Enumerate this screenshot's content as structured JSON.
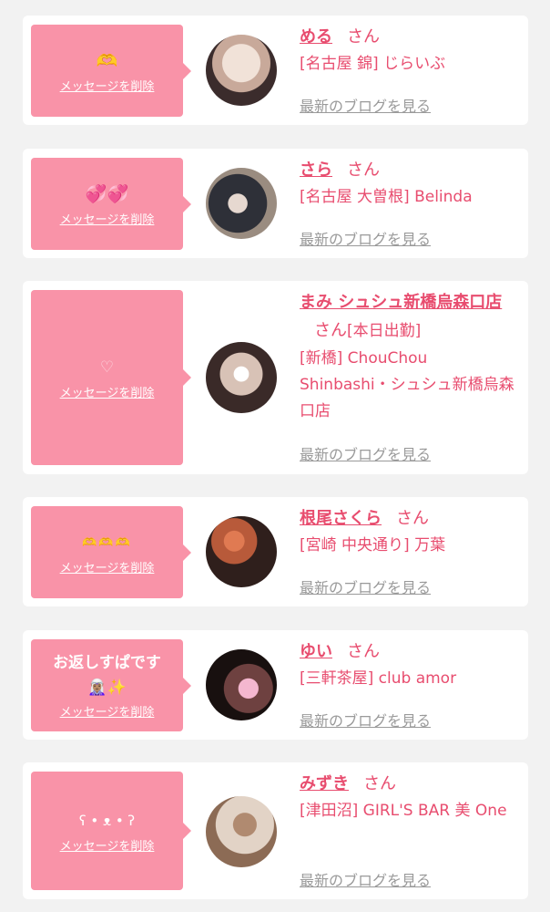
{
  "delete_label": "メッセージを削除",
  "san_label": "さん",
  "blog_label": "最新のブログを見る",
  "items": [
    {
      "message": "🫶",
      "name": "める",
      "work_status": "",
      "shop": "[名古屋 錦] じらいぶ",
      "avatar_colors": [
        "#e7d6cc",
        "#3b2c2c"
      ]
    },
    {
      "message": "💞💞",
      "name": "さら",
      "work_status": "",
      "shop": "[名古屋 大曽根] Belinda",
      "avatar_colors": [
        "#9a8c80",
        "#2e3038"
      ]
    },
    {
      "message": "♡",
      "name": "まみ シュシュ新橋烏森口店",
      "work_status": "[本日出勤]",
      "shop": "[新橋] ChouChou Shinbashi・シュシュ新橋烏森口店",
      "avatar_colors": [
        "#c9b3a6",
        "#3a2a28"
      ]
    },
    {
      "message": "🫶🫶🫶",
      "name": "根尾さくら",
      "work_status": "",
      "shop": "[宮崎 中央通り] 万葉",
      "avatar_colors": [
        "#b85a3a",
        "#2f1f1c"
      ]
    },
    {
      "message": "お返しすぱです 🧝🏽‍♀️✨",
      "name": "ゆい",
      "work_status": "",
      "shop": "[三軒茶屋] club amor",
      "avatar_colors": [
        "#6e4140",
        "#18100f"
      ]
    },
    {
      "message": "ʕ • ᴥ • ʔ",
      "name": "みずき",
      "work_status": "",
      "shop": "[津田沼] GIRL'S BAR 美 One",
      "avatar_colors": [
        "#e2d3c6",
        "#8c6b55"
      ]
    }
  ]
}
